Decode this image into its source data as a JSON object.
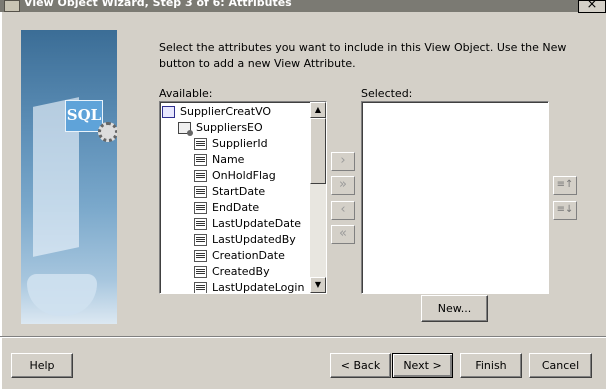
{
  "window": {
    "title": "View Object Wizard, Step 3 of 6: Attributes",
    "close_glyph": "×"
  },
  "instructions": "Select the attributes you want to include in this View Object.  Use the New button to add a new View Attribute.",
  "available": {
    "label": "Available:",
    "root": "SupplierCreatVO",
    "entity": "SuppliersEO",
    "attributes": [
      "SupplierId",
      "Name",
      "OnHoldFlag",
      "StartDate",
      "EndDate",
      "LastUpdateDate",
      "LastUpdatedBy",
      "CreationDate",
      "CreatedBy",
      "LastUpdateLogin"
    ]
  },
  "selected": {
    "label": "Selected:",
    "items": []
  },
  "shuttle": {
    "move": "›",
    "move_all": "»",
    "remove": "‹",
    "remove_all": "«"
  },
  "reorder": {
    "up": "≡↑",
    "down": "≡↓"
  },
  "art": {
    "badge": "SQL"
  },
  "buttons": {
    "new": "New...",
    "help": "Help",
    "back": "< Back",
    "next": "Next >",
    "finish": "Finish",
    "cancel": "Cancel"
  },
  "icons": {
    "vo": "view-object-icon",
    "eo": "entity-object-icon",
    "attr": "attribute-icon",
    "gear": "gear-icon"
  }
}
